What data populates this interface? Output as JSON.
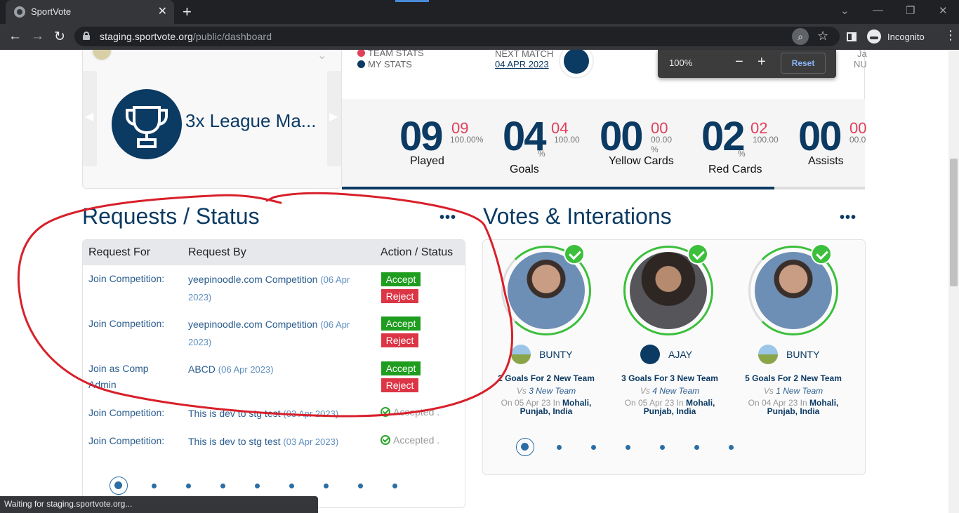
{
  "browser": {
    "tab_title": "SportVote",
    "url_domain": "staging.sportvote.org",
    "url_path": "/public/dashboard",
    "profile_label": "Incognito",
    "status_text": "Waiting for staging.sportvote.org..."
  },
  "zoom_popup": {
    "level": "100%",
    "reset_label": "Reset"
  },
  "achievement": {
    "title": "3x League Ma..."
  },
  "stats_header": {
    "team_stats_label": "TEAM STATS",
    "my_stats_label": "MY STATS",
    "next_match_label": "NEXT MATCH",
    "next_match_date": "04 APR 2023",
    "corner_top": "Ja",
    "corner_bottom": "NU"
  },
  "stats": [
    {
      "value": "09",
      "team": "09",
      "pct": "100.00%",
      "label": "Played"
    },
    {
      "value": "04",
      "team": "04",
      "pct": "100.00",
      "pct_sign": "%",
      "label": "Goals"
    },
    {
      "value": "00",
      "team": "00",
      "pct": "00.00 %",
      "label": "Yellow Cards"
    },
    {
      "value": "02",
      "team": "02",
      "pct": "100.00",
      "pct_sign": "%",
      "label": "Red Cards"
    },
    {
      "value": "00",
      "team": "00",
      "pct": "00.0",
      "label": "Assists"
    }
  ],
  "stats_progress_fraction": 0.827,
  "requests": {
    "title": "Requests / Status",
    "more": "•••",
    "headers": {
      "request_for": "Request For",
      "request_by": "Request By",
      "action": "Action / Status"
    },
    "accept_label": "Accept",
    "reject_label": "Reject",
    "rows": [
      {
        "for": "Join Competition:",
        "by": "yeepinoodle.com Competition",
        "date": "(06 Apr 2023)"
      },
      {
        "for": "Join Competition:",
        "by": "yeepinoodle.com Competition",
        "date": "(06 Apr 2023)"
      },
      {
        "for": "Join as Comp Admin",
        "by": "ABCD",
        "date": "(06 Apr 2023)"
      },
      {
        "for": "Join Competition:",
        "by": "This is dev to stg test",
        "date": "(03 Apr 2023)",
        "status": "Accepted ."
      },
      {
        "for": "Join Competition:",
        "by": "This is dev to stg test",
        "date": "(03 Apr 2023)",
        "status": "Accepted ."
      }
    ]
  },
  "votes": {
    "title": "Votes & Interations",
    "more": "•••",
    "cards": [
      {
        "name": "BUNTY",
        "line1": "2 Goals For 2 New Team",
        "vs": "Vs",
        "opponent": "3 New Team",
        "date_text": "On 05 Apr 23 In",
        "place": "Mohali,",
        "place2": "Punjab, India"
      },
      {
        "name": "AJAY",
        "line1": "3 Goals For 3 New Team",
        "vs": "Vs",
        "opponent": "4 New Team",
        "date_text": "On 05 Apr 23 In",
        "place": "Mohali,",
        "place2": "Punjab, India"
      },
      {
        "name": "BUNTY",
        "line1": "5 Goals For 2 New Team",
        "vs": "Vs",
        "opponent": "1 New Team",
        "date_text": "On 04 Apr 23 In",
        "place": "Mohali,",
        "place2": "Punjab, India"
      }
    ]
  },
  "colors": {
    "brand_navy": "#0b3a63",
    "accept_green": "#1e9d1e",
    "reject_red": "#dc3545",
    "annotation_red": "#d8202a",
    "stat_red": "#e0405a"
  },
  "icons": [
    "globe-icon",
    "close-icon",
    "plus-icon",
    "back-arrow-icon",
    "forward-arrow-icon",
    "reload-icon",
    "lock-icon",
    "zoom-icon",
    "star-icon",
    "side-panel-icon",
    "incognito-icon",
    "kebab-menu-icon",
    "trophy-icon",
    "team-logo-icon",
    "check-icon"
  ]
}
